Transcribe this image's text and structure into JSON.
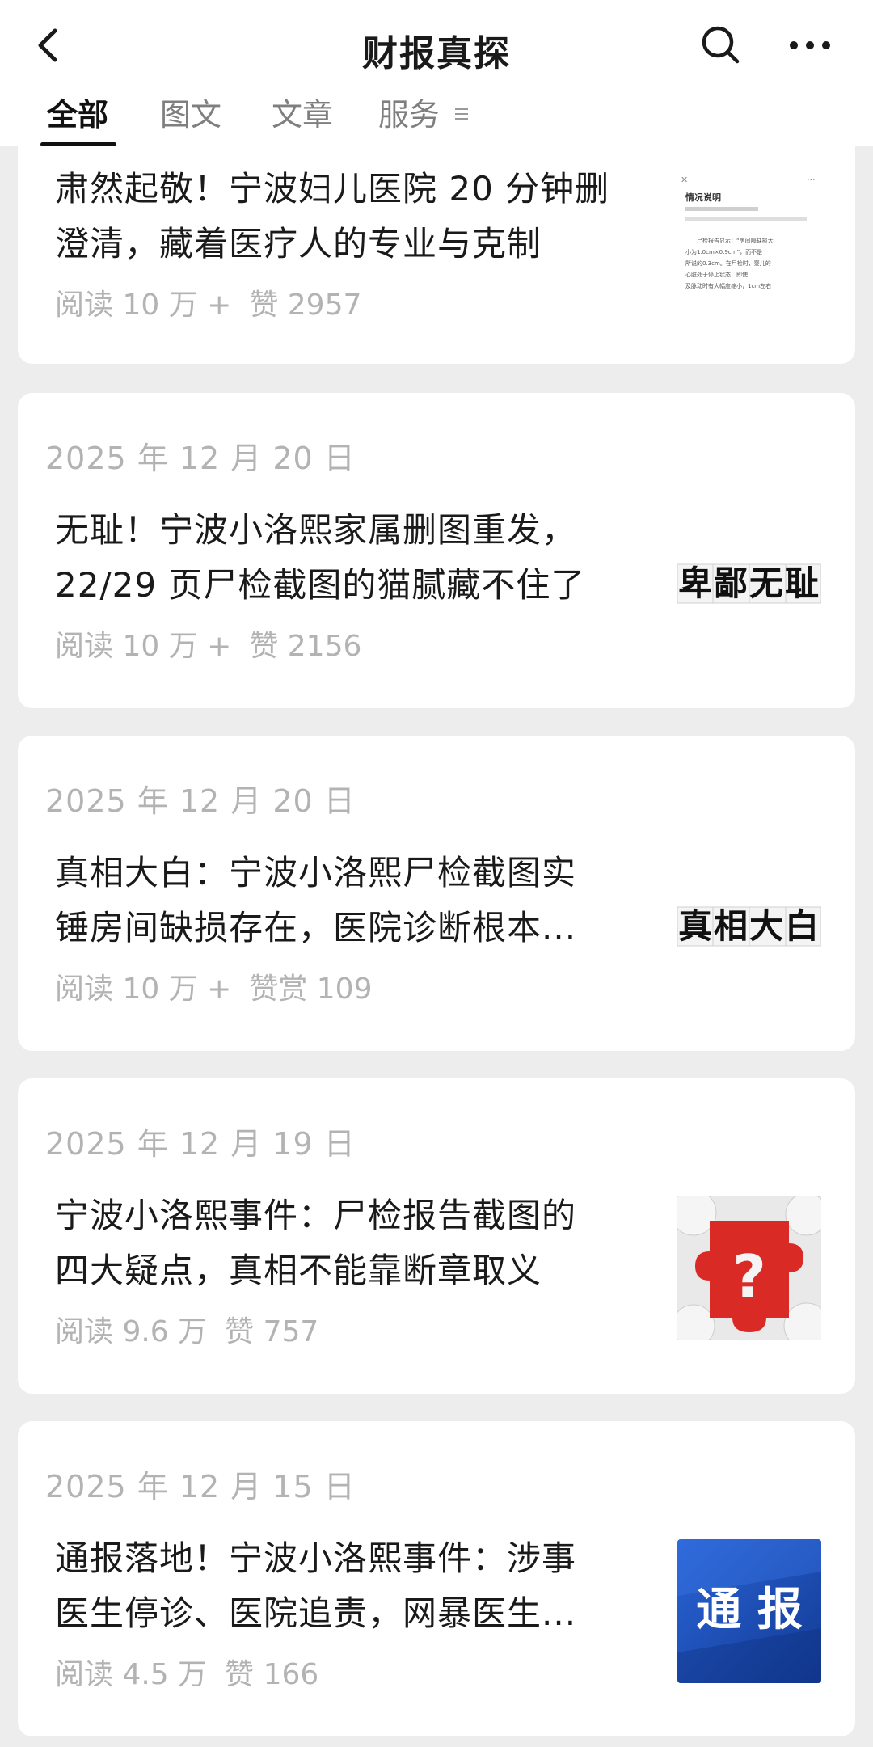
{
  "header": {
    "title": "财报真探",
    "tabs": [
      {
        "label": "全部",
        "active": true
      },
      {
        "label": "图文",
        "active": false
      },
      {
        "label": "文章",
        "active": false
      },
      {
        "label": "服务",
        "active": false
      }
    ]
  },
  "articles": [
    {
      "date": "",
      "title_lines": [
        "肃然起敬！宁波妇儿医院 20 分钟删",
        "澄清，藏着医疗人的专业与克制"
      ],
      "reads": "阅读 10 万 +",
      "likes": "赞 2957",
      "thumb": {
        "kind": "document",
        "doc_title": "情况说明",
        "doc_lines": [
          "尸检报告显示：“房间隔缺损大",
          "小为1.0cm×0.9cm”，而不是",
          "所说的0.3cm。在尸检时，婴儿的",
          "心脏处于停止状态，即使",
          "及脉动时有大幅度缩小，1cm左右"
        ]
      }
    },
    {
      "date": "2025 年 12 月 20 日",
      "title_lines": [
        "无耻！宁波小洛熙家属删图重发，",
        "22/29 页尸检截图的猫腻藏不住了"
      ],
      "reads": "阅读 10 万 +",
      "likes": "赞 2156",
      "thumb": {
        "kind": "text",
        "text": "卑鄙无耻"
      }
    },
    {
      "date": "2025 年 12 月 20 日",
      "title_lines": [
        "真相大白：宁波小洛熙尸检截图实",
        "锤房间缺损存在，医院诊断根本..."
      ],
      "reads": "阅读 10 万 +",
      "likes": "赞赏 109",
      "thumb": {
        "kind": "text",
        "text": "真相大白"
      }
    },
    {
      "date": "2025 年 12 月 19 日",
      "title_lines": [
        "宁波小洛熙事件：尸检报告截图的",
        "四大疑点，真相不能靠断章取义"
      ],
      "reads": "阅读 9.6 万",
      "likes": "赞 757",
      "thumb": {
        "kind": "puzzle",
        "symbol": "?"
      }
    },
    {
      "date": "2025 年 12 月 15 日",
      "title_lines": [
        "通报落地！宁波小洛熙事件：涉事",
        "医生停诊、医院追责，网暴医生..."
      ],
      "reads": "阅读 4.5 万",
      "likes": "赞 166",
      "thumb": {
        "kind": "banner",
        "text": "通 报"
      }
    }
  ],
  "colors": {
    "background": "#ededed",
    "card": "#ffffff",
    "meta_text": "#b3b3b3",
    "puzzle_red": "#d92a26",
    "banner_blue": "#1c4fb8"
  }
}
